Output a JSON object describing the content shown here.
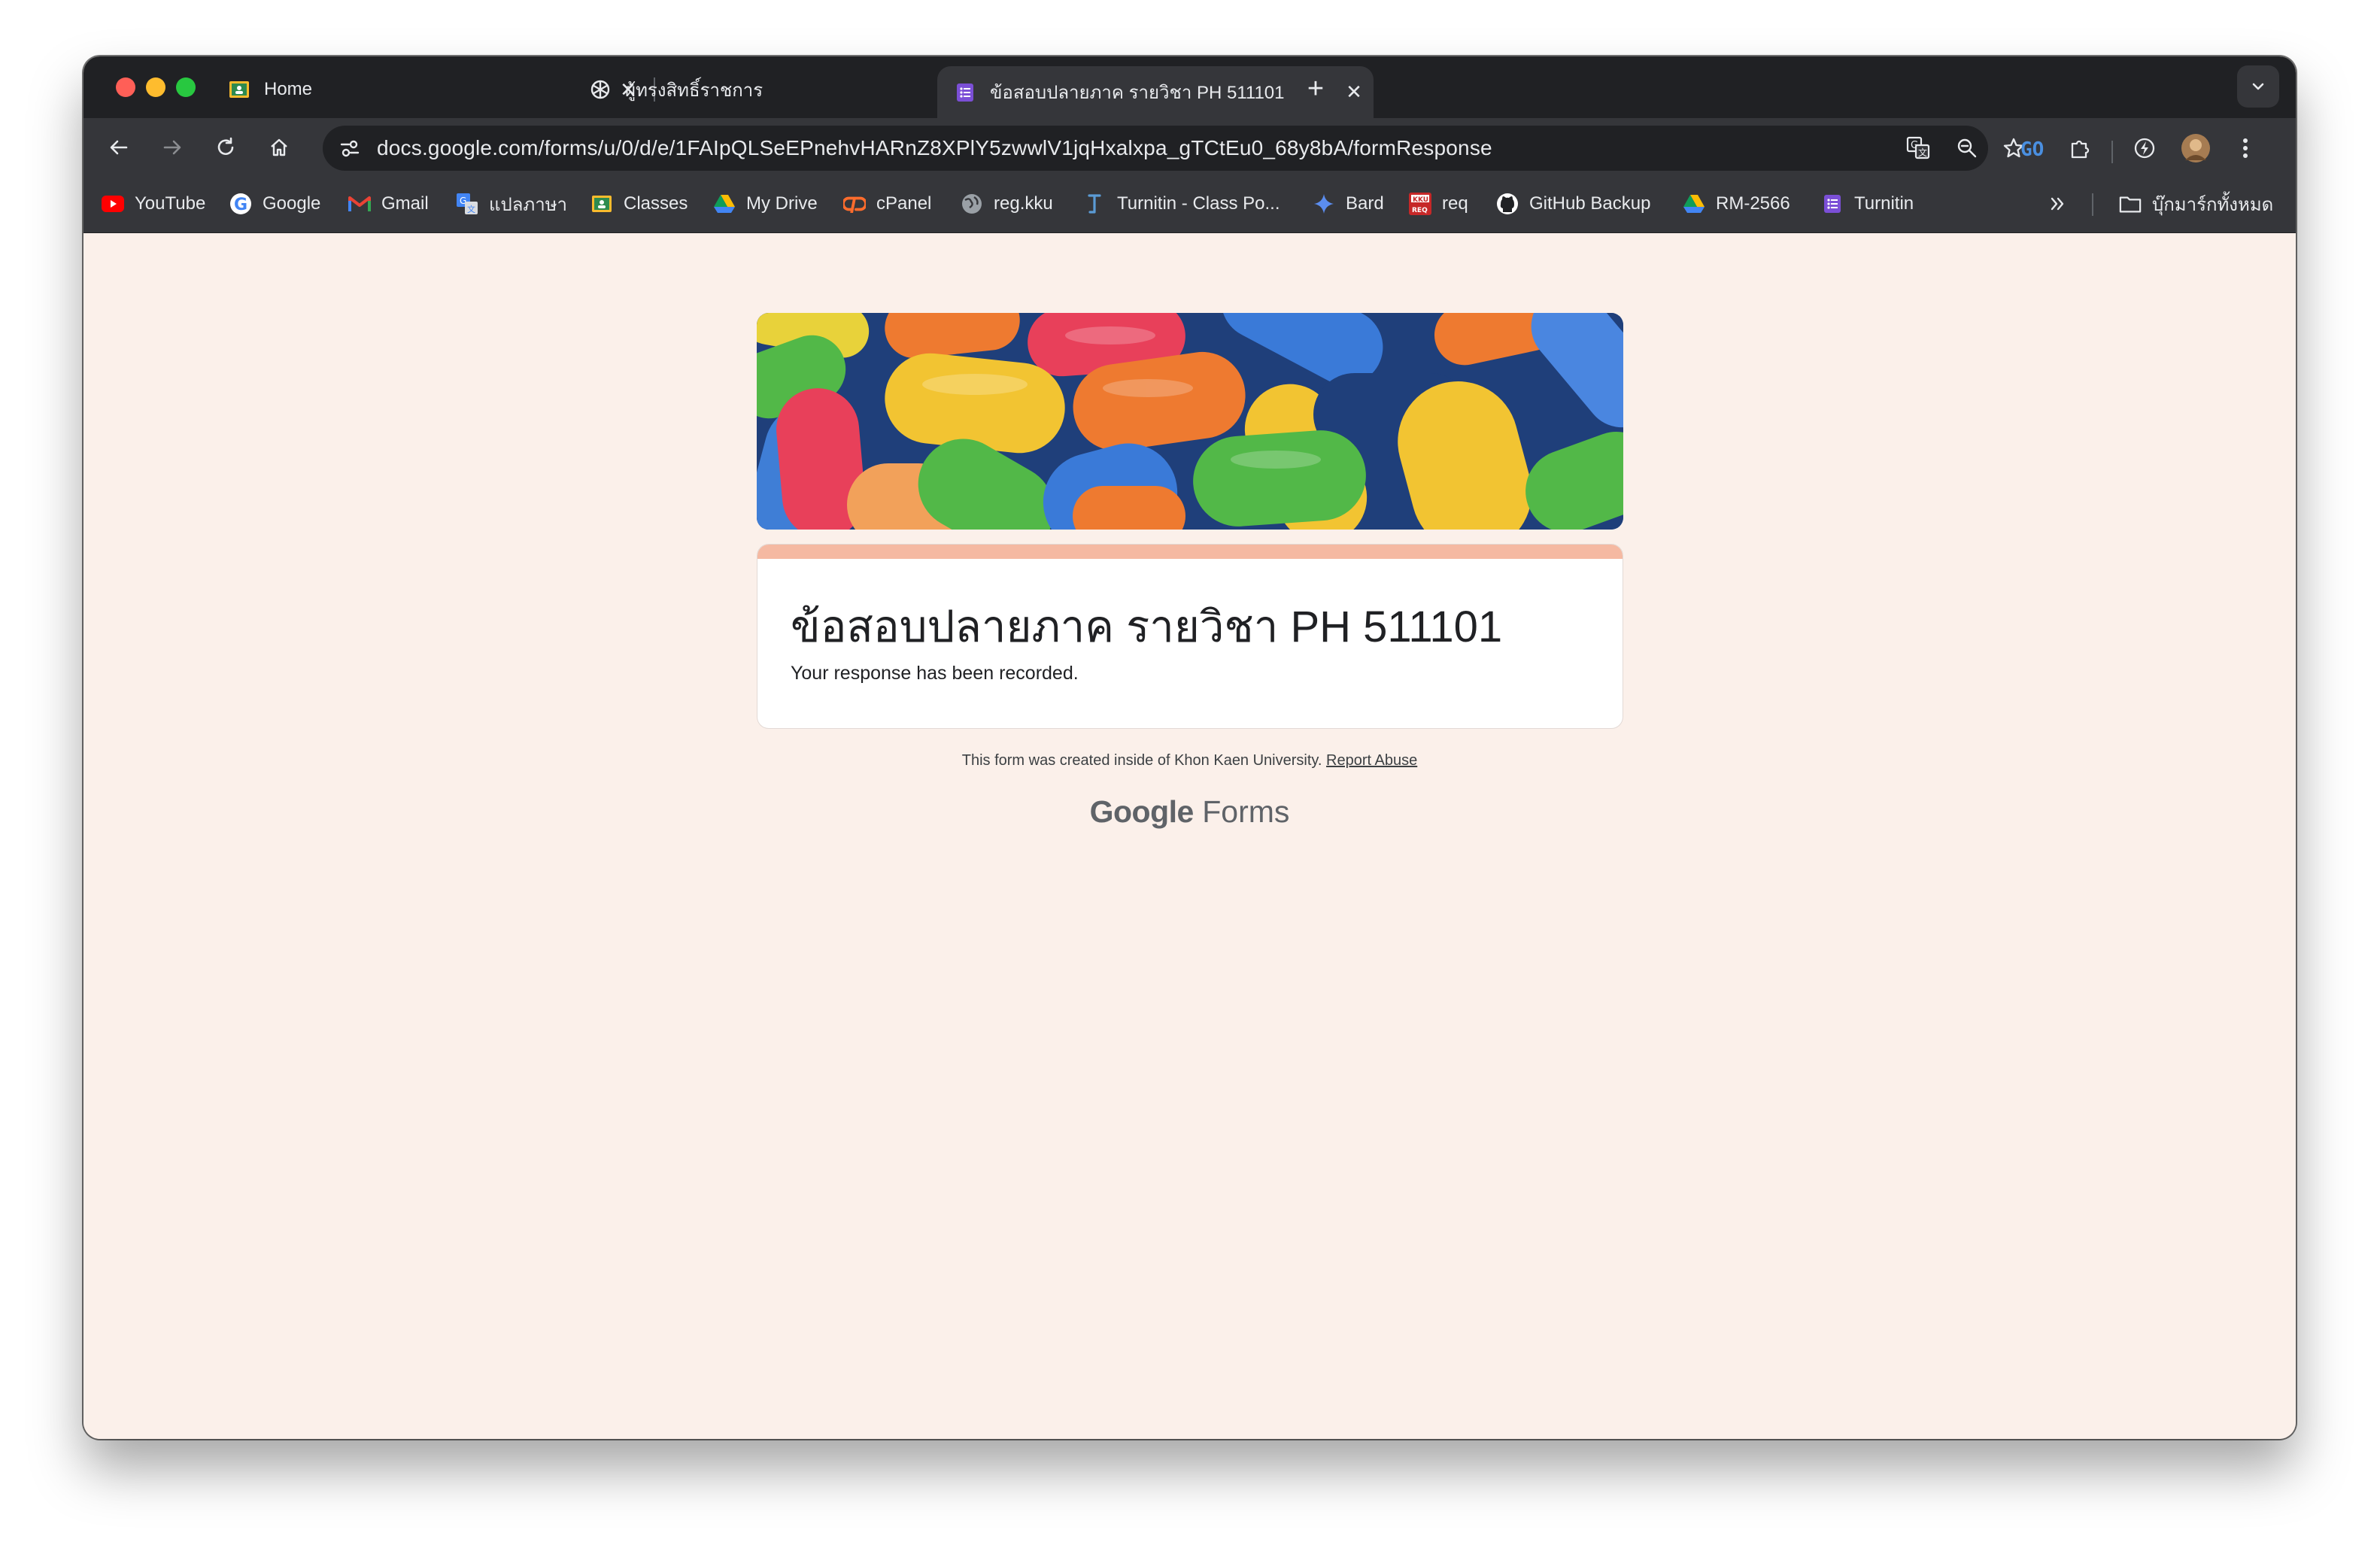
{
  "browser": {
    "tabs": [
      {
        "title": "Home",
        "favicon": "google-classroom-icon",
        "active": false
      },
      {
        "title": "ผู้ทรงสิทธิ์ราชการ",
        "favicon": "openai-icon",
        "active": false
      },
      {
        "title": "ข้อสอบปลายภาค รายวิชา PH 511101",
        "favicon": "google-forms-icon",
        "active": true
      }
    ],
    "new_tab_label": "+",
    "url": "docs.google.com/forms/u/0/d/e/1FAIpQLSeEPnehvHARnZ8XPlY5zwwlV1jqHxalxpa_gTCtEu0_68y8bA/formResponse",
    "bookmarks": [
      {
        "label": "YouTube",
        "icon": "youtube-icon"
      },
      {
        "label": "Google",
        "icon": "google-icon"
      },
      {
        "label": "Gmail",
        "icon": "gmail-icon"
      },
      {
        "label": "แปลภาษา",
        "icon": "translate-icon"
      },
      {
        "label": "Classes",
        "icon": "google-classroom-icon"
      },
      {
        "label": "My Drive",
        "icon": "google-drive-icon"
      },
      {
        "label": "cPanel",
        "icon": "cpanel-icon"
      },
      {
        "label": "reg.kku",
        "icon": "globe-icon"
      },
      {
        "label": "Turnitin - Class Po...",
        "icon": "turnitin-icon"
      },
      {
        "label": "Bard",
        "icon": "bard-sparkle-icon"
      },
      {
        "label": "req",
        "icon": "kku-req-icon"
      },
      {
        "label": "GitHub Backup",
        "icon": "github-icon"
      },
      {
        "label": "RM-2566",
        "icon": "google-drive-icon"
      },
      {
        "label": "Turnitin",
        "icon": "google-forms-icon"
      }
    ],
    "all_bookmarks_label": "บุ๊กมาร์กทั้งหมด",
    "kku_req_badge_top": "KKU",
    "kku_req_badge_bottom": "REQ"
  },
  "form": {
    "title": "ข้อสอบปลายภาค รายวิชา PH 511101",
    "confirmation": "Your response has been recorded.",
    "footer_text": "This form was created inside of Khon Kaen University.",
    "report_abuse": "Report Abuse",
    "brand_google": "Google",
    "brand_forms": "Forms"
  },
  "colors": {
    "accent": "#f5b9a2",
    "page_bg": "#fbf0ea",
    "chrome_dark": "#202124",
    "chrome_toolbar": "#35363a"
  }
}
